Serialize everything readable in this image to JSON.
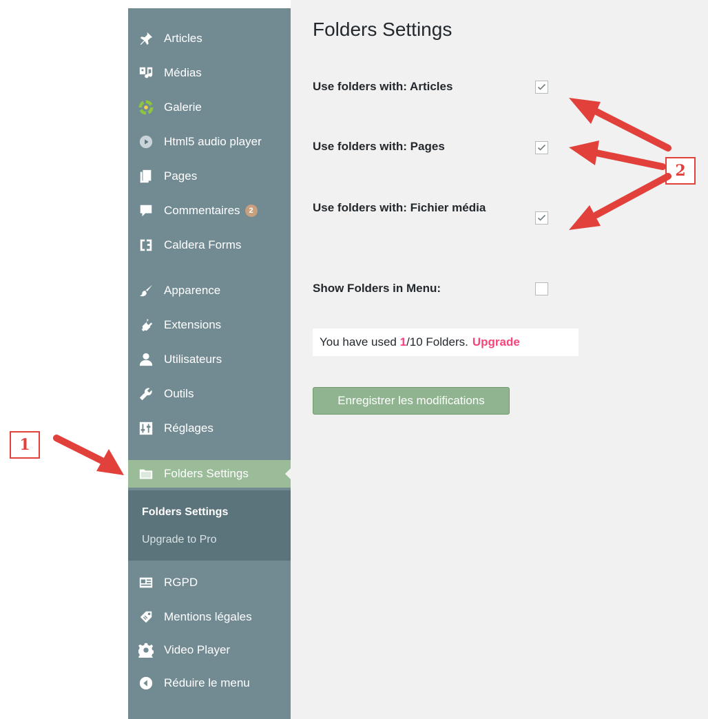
{
  "sidebar": {
    "items": [
      {
        "label": "Articles",
        "icon": "pin-icon"
      },
      {
        "label": "Médias",
        "icon": "media-icon"
      },
      {
        "label": "Galerie",
        "icon": "gallery-icon"
      },
      {
        "label": "Html5 audio player",
        "icon": "play-circle-icon"
      },
      {
        "label": "Pages",
        "icon": "pages-icon"
      },
      {
        "label": "Commentaires",
        "icon": "comment-icon",
        "badge": "2"
      },
      {
        "label": "Caldera Forms",
        "icon": "caldera-icon"
      },
      {
        "label": "Apparence",
        "icon": "brush-icon"
      },
      {
        "label": "Extensions",
        "icon": "plugin-icon"
      },
      {
        "label": "Utilisateurs",
        "icon": "user-icon"
      },
      {
        "label": "Outils",
        "icon": "wrench-icon"
      },
      {
        "label": "Réglages",
        "icon": "settings-icon"
      },
      {
        "label": "Folders Settings",
        "icon": "folder-icon"
      },
      {
        "label": "RGPD",
        "icon": "id-card-icon"
      },
      {
        "label": "Mentions légales",
        "icon": "tag-icon"
      },
      {
        "label": "Video Player",
        "icon": "gear-icon"
      },
      {
        "label": "Réduire le menu",
        "icon": "collapse-icon"
      }
    ],
    "submenu": {
      "current": "Folders Settings",
      "upgrade": "Upgrade to Pro"
    }
  },
  "main": {
    "title": "Folders Settings",
    "options": [
      {
        "label": "Use folders with: Articles",
        "checked": true
      },
      {
        "label": "Use folders with: Pages",
        "checked": true
      },
      {
        "label": "Use folders with: Fichier média",
        "checked": true
      },
      {
        "label": "Show Folders in Menu:",
        "checked": false
      }
    ],
    "usage": {
      "prefix": "You have used ",
      "used": "1",
      "suffix": "/10 Folders.",
      "upgrade_label": "Upgrade"
    },
    "save_label": "Enregistrer les modifications"
  },
  "callouts": {
    "one": "1",
    "two": "2"
  },
  "colors": {
    "sidebar": "#728b93",
    "active": "#9bbc98",
    "submenu": "#5b737b",
    "accent_pink": "#f5457a",
    "arrow_red": "#e1413a",
    "save_button": "#8fb48f"
  }
}
